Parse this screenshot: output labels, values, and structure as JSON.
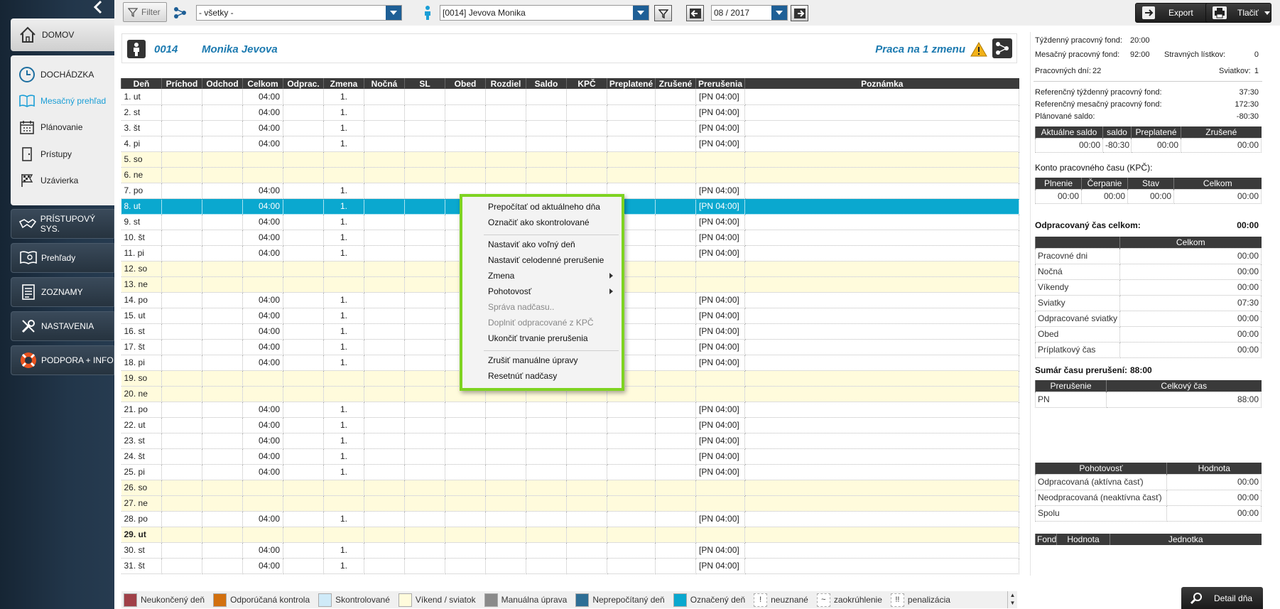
{
  "sidebar": {
    "main": [
      {
        "label": "DOMOV",
        "icon": "home-icon"
      },
      {
        "label": "DOCHÁDZKA",
        "icon": "clock-icon"
      }
    ],
    "sub": [
      {
        "label": "Mesačný prehľad",
        "icon": "book-icon",
        "active": true
      },
      {
        "label": "Plánovanie",
        "icon": "calendar-icon"
      },
      {
        "label": "Prístupy",
        "icon": "door-icon"
      },
      {
        "label": "Uzávierka",
        "icon": "checkered-flag-icon"
      }
    ],
    "bottom": [
      {
        "label": "PRÍSTUPOVÝ SYS.",
        "icon": "handshake-icon"
      },
      {
        "label": "Prehľady",
        "icon": "report-book-icon"
      },
      {
        "label": "ZOZNAMY",
        "icon": "list-icon"
      },
      {
        "label": "NASTAVENIA",
        "icon": "tools-icon"
      },
      {
        "label": "PODPORA + INFO",
        "icon": "lifebuoy-icon"
      }
    ]
  },
  "toolbar": {
    "filter_label": "Filter",
    "group_value": "- všetky -",
    "employee_value": "[0014] Jevova Monika",
    "period_value": "08 / 2017",
    "export_label": "Export",
    "print_label": "Tlačiť"
  },
  "header": {
    "emp_id": "0014",
    "emp_name": "Monika Jevova",
    "shift_label": "Praca na 1 zmenu"
  },
  "table": {
    "columns": [
      "Deň",
      "Príchod",
      "Odchod",
      "Celkom",
      "Odprac.",
      "Zmena",
      "Nočná",
      "SL",
      "Obed",
      "Rozdiel",
      "Saldo",
      "KPČ",
      "Preplatené",
      "Zrušené",
      "Prerušenia",
      "Poznámka"
    ],
    "rows": [
      {
        "day": "1. ut",
        "celkom": "04:00",
        "zmena": "1.",
        "prerusenia": "[PN 04:00]",
        "type": "work"
      },
      {
        "day": "2. st",
        "celkom": "04:00",
        "zmena": "1.",
        "prerusenia": "[PN 04:00]",
        "type": "work"
      },
      {
        "day": "3. št",
        "celkom": "04:00",
        "zmena": "1.",
        "prerusenia": "[PN 04:00]",
        "type": "work"
      },
      {
        "day": "4. pi",
        "celkom": "04:00",
        "zmena": "1.",
        "prerusenia": "[PN 04:00]",
        "type": "work"
      },
      {
        "day": "5. so",
        "celkom": "",
        "zmena": "",
        "prerusenia": "",
        "type": "weekend"
      },
      {
        "day": "6. ne",
        "celkom": "",
        "zmena": "",
        "prerusenia": "",
        "type": "weekend"
      },
      {
        "day": "7. po",
        "celkom": "04:00",
        "zmena": "1.",
        "prerusenia": "[PN 04:00]",
        "type": "work"
      },
      {
        "day": "8. ut",
        "celkom": "04:00",
        "zmena": "1.",
        "prerusenia": "[PN 04:00]",
        "type": "selected"
      },
      {
        "day": "9. st",
        "celkom": "04:00",
        "zmena": "1.",
        "prerusenia": "[PN 04:00]",
        "type": "work"
      },
      {
        "day": "10. št",
        "celkom": "04:00",
        "zmena": "1.",
        "prerusenia": "[PN 04:00]",
        "type": "work"
      },
      {
        "day": "11. pi",
        "celkom": "04:00",
        "zmena": "1.",
        "prerusenia": "[PN 04:00]",
        "type": "work"
      },
      {
        "day": "12. so",
        "celkom": "",
        "zmena": "",
        "prerusenia": "",
        "type": "weekend"
      },
      {
        "day": "13. ne",
        "celkom": "",
        "zmena": "",
        "prerusenia": "",
        "type": "weekend"
      },
      {
        "day": "14. po",
        "celkom": "04:00",
        "zmena": "1.",
        "prerusenia": "[PN 04:00]",
        "type": "work"
      },
      {
        "day": "15. ut",
        "celkom": "04:00",
        "zmena": "1.",
        "prerusenia": "[PN 04:00]",
        "type": "work"
      },
      {
        "day": "16. st",
        "celkom": "04:00",
        "zmena": "1.",
        "prerusenia": "[PN 04:00]",
        "type": "work"
      },
      {
        "day": "17. št",
        "celkom": "04:00",
        "zmena": "1.",
        "prerusenia": "[PN 04:00]",
        "type": "work"
      },
      {
        "day": "18. pi",
        "celkom": "04:00",
        "zmena": "1.",
        "prerusenia": "[PN 04:00]",
        "type": "work"
      },
      {
        "day": "19. so",
        "celkom": "",
        "zmena": "",
        "prerusenia": "",
        "type": "weekend"
      },
      {
        "day": "20. ne",
        "celkom": "",
        "zmena": "",
        "prerusenia": "",
        "type": "weekend"
      },
      {
        "day": "21. po",
        "celkom": "04:00",
        "zmena": "1.",
        "prerusenia": "[PN 04:00]",
        "type": "work"
      },
      {
        "day": "22. ut",
        "celkom": "04:00",
        "zmena": "1.",
        "prerusenia": "[PN 04:00]",
        "type": "work"
      },
      {
        "day": "23. st",
        "celkom": "04:00",
        "zmena": "1.",
        "prerusenia": "[PN 04:00]",
        "type": "work"
      },
      {
        "day": "24. št",
        "celkom": "04:00",
        "zmena": "1.",
        "prerusenia": "[PN 04:00]",
        "type": "work"
      },
      {
        "day": "25. pi",
        "celkom": "04:00",
        "zmena": "1.",
        "prerusenia": "[PN 04:00]",
        "type": "work"
      },
      {
        "day": "26. so",
        "celkom": "",
        "zmena": "",
        "prerusenia": "",
        "type": "weekend"
      },
      {
        "day": "27. ne",
        "celkom": "",
        "zmena": "",
        "prerusenia": "",
        "type": "weekend"
      },
      {
        "day": "28. po",
        "celkom": "04:00",
        "zmena": "1.",
        "prerusenia": "[PN 04:00]",
        "type": "work"
      },
      {
        "day": "29. ut",
        "celkom": "",
        "zmena": "",
        "prerusenia": "",
        "type": "holiday"
      },
      {
        "day": "30. st",
        "celkom": "04:00",
        "zmena": "1.",
        "prerusenia": "[PN 04:00]",
        "type": "work"
      },
      {
        "day": "31. št",
        "celkom": "04:00",
        "zmena": "1.",
        "prerusenia": "[PN 04:00]",
        "type": "work"
      }
    ]
  },
  "context_menu": {
    "items": [
      {
        "label": "Prepočítať od aktuálneho dňa",
        "enabled": true
      },
      {
        "label": "Označiť ako skontrolované",
        "enabled": true
      },
      {
        "label": "Nastaviť ako voľný deň",
        "enabled": true
      },
      {
        "label": "Nastaviť celodenné prerušenie",
        "enabled": true
      },
      {
        "label": "Zmena",
        "enabled": true,
        "submenu": true
      },
      {
        "label": "Pohotovosť",
        "enabled": true,
        "submenu": true
      },
      {
        "label": "Správa nadčasu..",
        "enabled": false
      },
      {
        "label": "Doplniť odpracované z KPČ",
        "enabled": false
      },
      {
        "label": "Ukončiť trvanie prerušenia",
        "enabled": true
      },
      {
        "label": "Zrušiť manuálne úpravy",
        "enabled": true
      },
      {
        "label": "Resetnúť nadčasy",
        "enabled": true
      }
    ]
  },
  "legend": [
    {
      "label": "Neukončený deň",
      "color": "#a04048"
    },
    {
      "label": "Odporúčaná kontrola",
      "color": "#d2700f"
    },
    {
      "label": "Skontrolované",
      "color": "#cfeaf8"
    },
    {
      "label": "Víkend / sviatok",
      "color": "#fffbdc"
    },
    {
      "label": "Manuálna úprava",
      "color": "#8a8a8a"
    },
    {
      "label": "Neprepočítaný deň",
      "color": "#2e6e95"
    },
    {
      "label": "Označený deň",
      "color": "#0aa8cf"
    },
    {
      "label": "neuznané",
      "symbol": "!"
    },
    {
      "label": "zaokrúhlenie",
      "symbol": "~"
    },
    {
      "label": "penalizácia",
      "symbol": "!!"
    }
  ],
  "summary": {
    "tyzdenny_label": "Týždenný pracovný fond:",
    "tyzdenny_value": "20:00",
    "mesacny_label": "Mesačný pracovný fond:",
    "mesacny_value": "92:00",
    "stravne_label": "Stravných lístkov:",
    "stravne_value": "0",
    "prac_dni_label": "Pracovných dní:",
    "prac_dni_value": "22",
    "sviatky_label": "Sviatkov:",
    "sviatky_value": "1",
    "ref_tyz_label": "Referenčný týždenný pracovný fond:",
    "ref_tyz_value": "37:30",
    "ref_mes_label": "Referenčný mesačný pracovný fond:",
    "ref_mes_value": "172:30",
    "plan_saldo_label": "Plánované saldo:",
    "plan_saldo_value": "-80:30",
    "saldo_headers": [
      "Aktuálne saldo",
      "saldo",
      "Preplatené",
      "Zrušené"
    ],
    "saldo_values": [
      "00:00",
      "-80:30",
      "00:00",
      "00:00"
    ],
    "kpc_title": "Konto pracovného času (KPČ):",
    "kpc_headers": [
      "Plnenie",
      "Čerpanie",
      "Stav",
      "Celkom"
    ],
    "kpc_values": [
      "00:00",
      "00:00",
      "00:00",
      "00:00"
    ],
    "odprac_label": "Odpracovaný čas celkom:",
    "odprac_value": "00:00",
    "celkom_header": "Celkom",
    "celkom_rows": [
      {
        "label": "Pracovné dni",
        "value": "00:00"
      },
      {
        "label": "Nočná",
        "value": "00:00"
      },
      {
        "label": "Víkendy",
        "value": "00:00"
      },
      {
        "label": "Sviatky",
        "value": "07:30"
      },
      {
        "label": "Odpracované sviatky",
        "value": "00:00"
      },
      {
        "label": "Obed",
        "value": "00:00"
      },
      {
        "label": "Príplatkový čas",
        "value": "00:00"
      }
    ],
    "prerus_label": "Sumár času prerušení:",
    "prerus_value": "88:00",
    "prerus_headers": [
      "Prerušenie",
      "Celkový čas"
    ],
    "prerus_rows": [
      {
        "label": "PN",
        "value": "88:00"
      }
    ],
    "pohot_headers": [
      "Pohotovosť",
      "Hodnota"
    ],
    "pohot_rows": [
      {
        "label": "Odpracovaná (aktívna časť)",
        "value": "00:00"
      },
      {
        "label": "Neodpracovaná (neaktívna časť)",
        "value": "00:00"
      },
      {
        "label": "Spolu",
        "value": "00:00"
      }
    ],
    "fond_headers": [
      "Fond",
      "Hodnota",
      "Jednotka"
    ]
  },
  "detail_label": "Detail dňa"
}
